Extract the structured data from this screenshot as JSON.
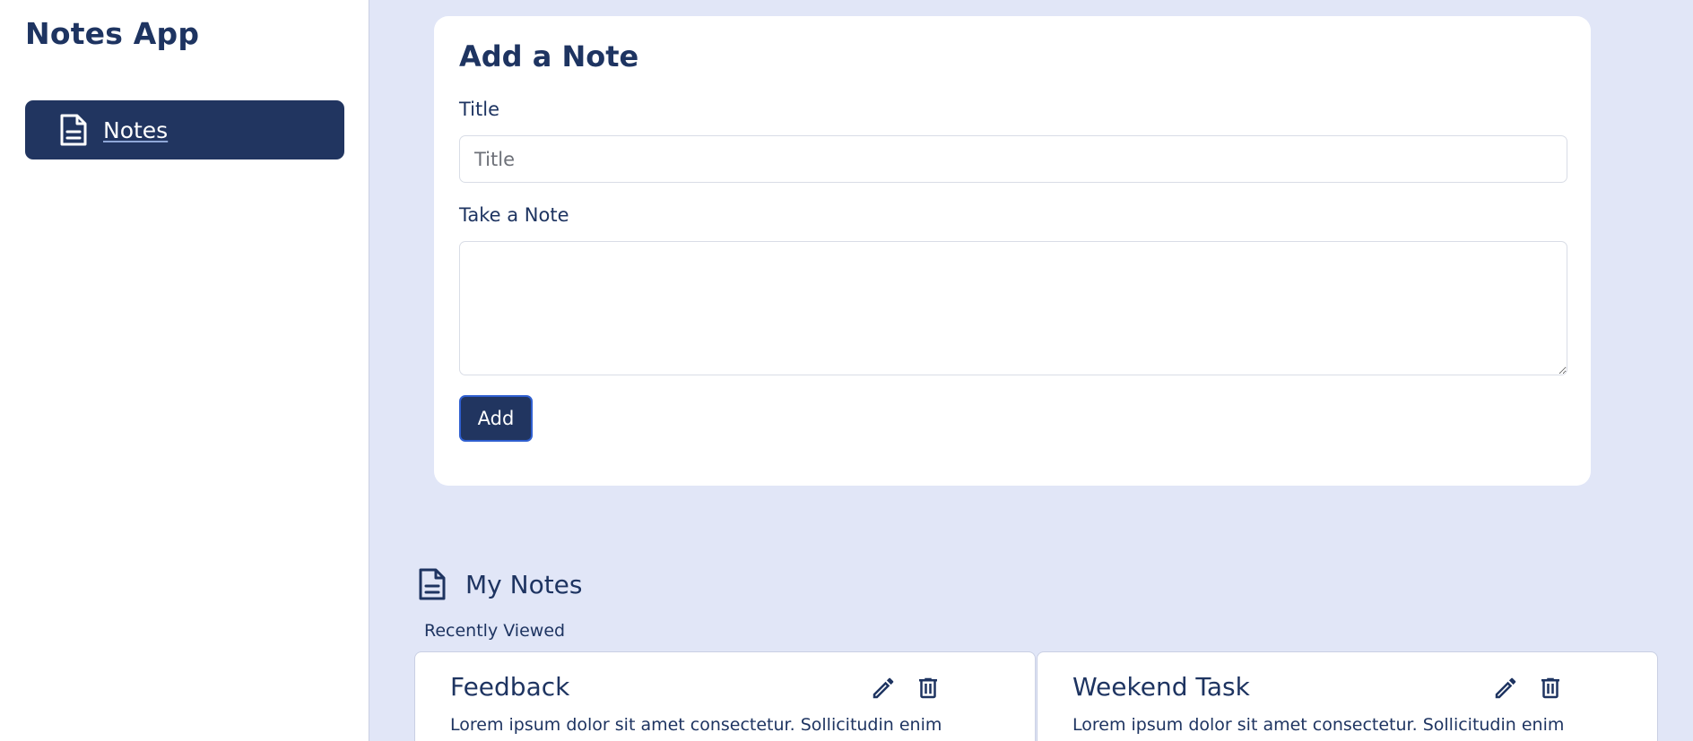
{
  "app": {
    "title": "Notes App"
  },
  "sidebar": {
    "items": [
      {
        "label": "Notes",
        "icon": "document-icon",
        "active": true
      }
    ]
  },
  "add_note": {
    "heading": "Add a Note",
    "title_label": "Title",
    "title_placeholder": "Title",
    "title_value": "",
    "note_label": "Take a Note",
    "note_value": "",
    "add_button": "Add"
  },
  "my_notes": {
    "heading": "My Notes",
    "subheading": "Recently Viewed",
    "notes": [
      {
        "title": "Feedback",
        "body": "Lorem ipsum dolor sit amet consectetur. Sollicitudin enim"
      },
      {
        "title": "Weekend Task",
        "body": "Lorem ipsum dolor sit amet consectetur. Sollicitudin enim"
      }
    ]
  },
  "colors": {
    "primary": "#213560",
    "text": "#1e3461",
    "background": "#e1e6f7",
    "surface": "#ffffff",
    "focus_border": "#2f5fd0"
  }
}
